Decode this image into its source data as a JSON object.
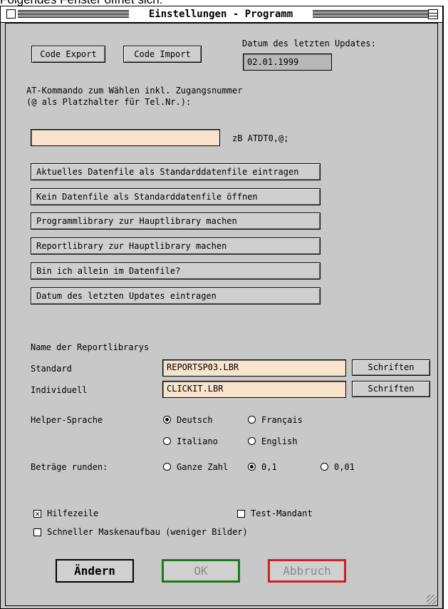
{
  "caption": "Folgendes Fenster öffnet sich:",
  "window": {
    "title": "Einstellungen - Programm"
  },
  "buttons": {
    "code_export": "Code Export",
    "code_import": "Code Import",
    "update_label": "Datum des letzten Updates:",
    "update_value": "02.01.1999"
  },
  "at": {
    "label_line1": "AT-Kommando zum Wählen inkl. Zugangsnummer",
    "label_line2": "(@ als Platzhalter für Tel.Nr.):",
    "value": "",
    "hint": "zB ATDT0,@;"
  },
  "actions": [
    "Aktuelles Datenfile als Standarddatenfile eintragen",
    "Kein Datenfile als Standarddatenfile öffnen",
    "Programmlibrary zur Hauptlibrary machen",
    "Reportlibrary zur Hauptlibrary machen",
    "Bin ich allein im Datenfile?",
    "Datum des letzten Updates eintragen"
  ],
  "report": {
    "heading": "Name der Reportlibrarys",
    "standard_label": "Standard",
    "standard_value": "REPORTSP03.LBR",
    "individual_label": "Individuell",
    "individual_value": "CLICKIT.LBR",
    "fonts_button": "Schriften"
  },
  "helper": {
    "label": "Helper-Sprache",
    "options": [
      "Deutsch",
      "Français",
      "Italiano",
      "English"
    ],
    "selected": "Deutsch"
  },
  "rounding": {
    "label": "Beträge runden:",
    "options": [
      "Ganze Zahl",
      "0,1",
      "0,01"
    ],
    "selected": "0,1"
  },
  "checks": {
    "help_line": {
      "label": "Hilfezeile",
      "checked": true
    },
    "test_client": {
      "label": "Test-Mandant",
      "checked": false
    },
    "fast_masks": {
      "label": "Schneller Maskenaufbau (weniger Bilder)",
      "checked": false
    }
  },
  "footer": {
    "change": "Ändern",
    "ok": "OK",
    "cancel": "Abbruch"
  },
  "colors": {
    "window_bg": "#c8c8c8",
    "field_bg": "#f8e4cc",
    "ok_border": "#1a7a1a",
    "cancel_border": "#cc2222"
  }
}
